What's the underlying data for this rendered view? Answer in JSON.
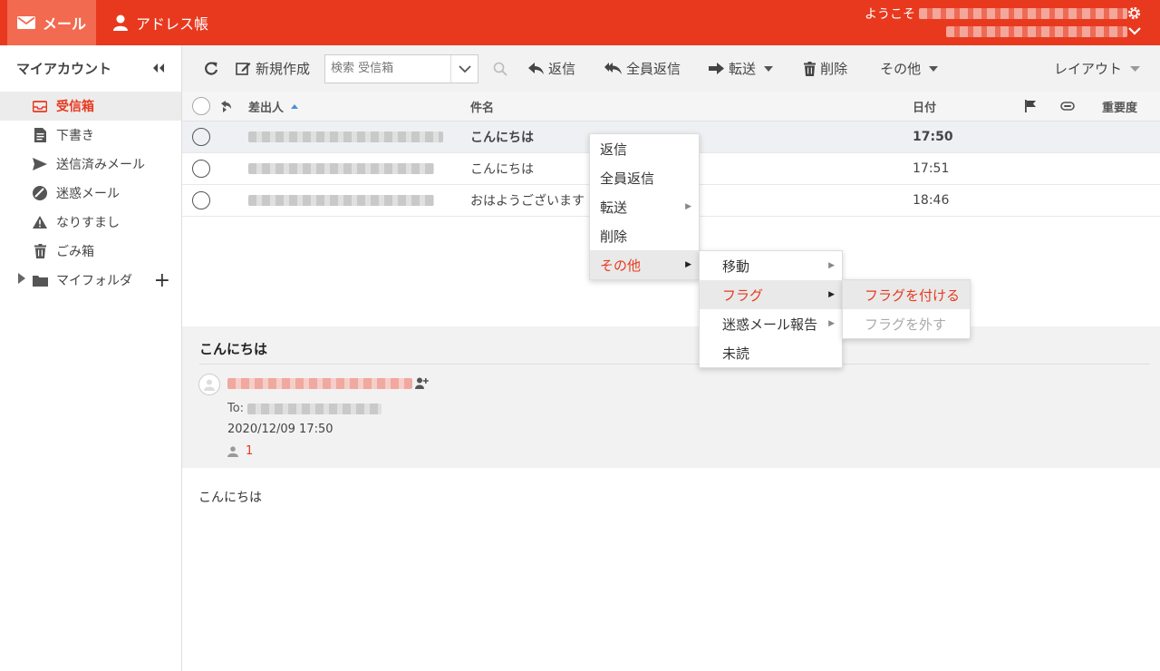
{
  "header": {
    "apps": {
      "mail": "メール",
      "address_book": "アドレス帳"
    },
    "welcome": "ようこそ"
  },
  "sidebar": {
    "title": "マイアカウント",
    "items": [
      {
        "label": "受信箱",
        "icon": "inbox-icon"
      },
      {
        "label": "下書き",
        "icon": "draft-icon"
      },
      {
        "label": "送信済みメール",
        "icon": "send-icon"
      },
      {
        "label": "迷惑メール",
        "icon": "spam-icon"
      },
      {
        "label": "なりすまし",
        "icon": "warning-icon"
      },
      {
        "label": "ごみ箱",
        "icon": "trash-icon"
      },
      {
        "label": "マイフォルダ",
        "icon": "folder-icon"
      }
    ]
  },
  "toolbar": {
    "compose": "新規作成",
    "search_placeholder": "検索 受信箱",
    "reply": "返信",
    "reply_all": "全員返信",
    "forward": "転送",
    "delete": "削除",
    "more": "その他",
    "layout": "レイアウト"
  },
  "table": {
    "columns": {
      "from": "差出人",
      "subject": "件名",
      "date": "日付",
      "priority": "重要度"
    },
    "rows": [
      {
        "subject": "こんにちは",
        "date": "17:50"
      },
      {
        "subject": "こんにちは",
        "date": "17:51"
      },
      {
        "subject": "おはようございます",
        "date": "18:46"
      }
    ]
  },
  "preview": {
    "subject": "こんにちは",
    "to_label": "To:",
    "date": "2020/12/09 17:50",
    "recipient_count": "1",
    "body": "こんにちは"
  },
  "context_menu": {
    "items": [
      "返信",
      "全員返信",
      "転送",
      "削除",
      "その他"
    ],
    "submenu": [
      "移動",
      "フラグ",
      "迷惑メール報告",
      "未読"
    ],
    "flag_submenu": [
      "フラグを付ける",
      "フラグを外す"
    ]
  },
  "colors": {
    "accent": "#e8391f",
    "toolbar_bg": "#f2f2f2",
    "selected_row": "#eef0f3"
  }
}
